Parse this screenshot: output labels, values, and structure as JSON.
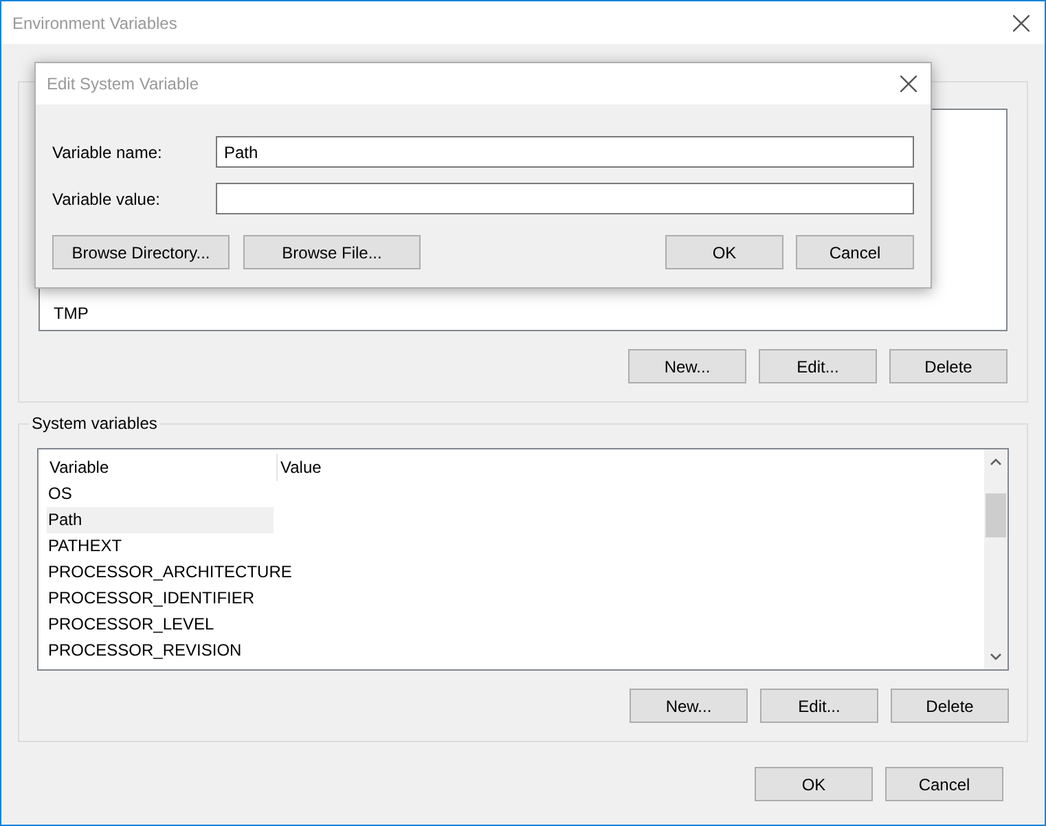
{
  "window": {
    "title": "Environment Variables"
  },
  "user_variables": {
    "rows": [
      {
        "variable": "TMP"
      }
    ],
    "buttons": [
      "New...",
      "Edit...",
      "Delete"
    ]
  },
  "system_variables": {
    "title": "System variables",
    "columns": [
      "Variable",
      "Value"
    ],
    "rows": [
      {
        "variable": "OS",
        "selected": false
      },
      {
        "variable": "Path",
        "selected": true
      },
      {
        "variable": "PATHEXT",
        "selected": false
      },
      {
        "variable": "PROCESSOR_ARCHITECTURE",
        "selected": false
      },
      {
        "variable": "PROCESSOR_IDENTIFIER",
        "selected": false
      },
      {
        "variable": "PROCESSOR_LEVEL",
        "selected": false
      },
      {
        "variable": "PROCESSOR_REVISION",
        "selected": false
      }
    ],
    "buttons": [
      "New...",
      "Edit...",
      "Delete"
    ]
  },
  "footer_buttons": [
    "OK",
    "Cancel"
  ],
  "dialog": {
    "title": "Edit System Variable",
    "fields": [
      {
        "label": "Variable name:",
        "value": "Path"
      },
      {
        "label": "Variable value:"
      }
    ],
    "left_buttons": [
      "Browse Directory...",
      "Browse File..."
    ],
    "right_buttons": [
      "OK",
      "Cancel"
    ]
  }
}
